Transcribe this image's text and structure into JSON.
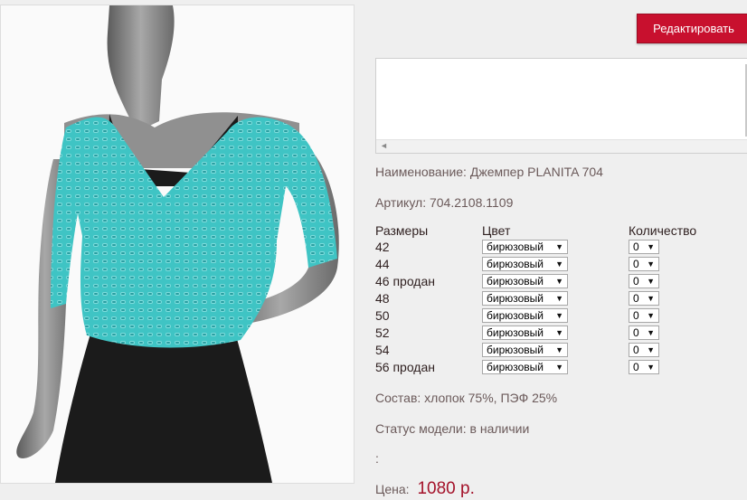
{
  "toolbar": {
    "edit_label": "Редактировать"
  },
  "description_box": {
    "text": ""
  },
  "product": {
    "name_label": "Наименование:",
    "name_value": "Джемпер PLANITA 704",
    "article_label": "Артикул:",
    "article_value": "704.2108.1109",
    "composition_label": "Состав:",
    "composition_value": "хлопок 75%, ПЭФ 25%",
    "status_label": "Статус модели:",
    "status_value": "в наличии",
    "extra_line": ":",
    "price_label": "Цена:",
    "price_value": "1080 р."
  },
  "sizes": {
    "headers": {
      "size": "Размеры",
      "color": "Цвет",
      "quantity": "Количество"
    },
    "rows": [
      {
        "size": "42",
        "color": "бирюзовый",
        "quantity": "0"
      },
      {
        "size": "44",
        "color": "бирюзовый",
        "quantity": "0"
      },
      {
        "size": "46 продан",
        "color": "бирюзовый",
        "quantity": "0"
      },
      {
        "size": "48",
        "color": "бирюзовый",
        "quantity": "0"
      },
      {
        "size": "50",
        "color": "бирюзовый",
        "quantity": "0"
      },
      {
        "size": "52",
        "color": "бирюзовый",
        "quantity": "0"
      },
      {
        "size": "54",
        "color": "бирюзовый",
        "quantity": "0"
      },
      {
        "size": "56 продан",
        "color": "бирюзовый",
        "quantity": "0"
      }
    ]
  },
  "colors": {
    "accent": "#c8102e",
    "price": "#a4122a",
    "garment": "#3fc4c4",
    "mannequin": "#8f8f8f",
    "skirt": "#1b1b1b"
  },
  "icons": {
    "select_arrow": "▼",
    "scroll_left": "◄"
  }
}
